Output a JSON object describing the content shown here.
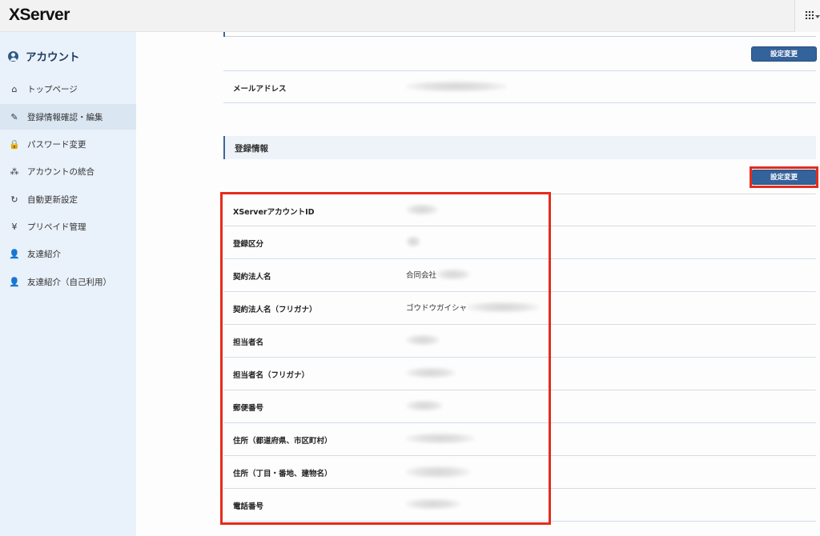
{
  "header": {
    "logo": "XServer",
    "menu_icon": "grid-icon"
  },
  "sidebar": {
    "title": "アカウント",
    "items": [
      {
        "label": "トップページ",
        "icon": "⌂"
      },
      {
        "label": "登録情報確認・編集",
        "icon": "✎",
        "active": true
      },
      {
        "label": "パスワード変更",
        "icon": "🔒"
      },
      {
        "label": "アカウントの統合",
        "icon": "⁂"
      },
      {
        "label": "自動更新設定",
        "icon": "↻"
      },
      {
        "label": "プリペイド管理",
        "icon": "¥"
      },
      {
        "label": "友達紹介",
        "icon": "👤"
      },
      {
        "label": "友達紹介（自己利用）",
        "icon": "👤"
      }
    ]
  },
  "main": {
    "button_label": "設定変更",
    "email_row": {
      "label": "メールアドレス"
    },
    "section_title": "登録情報",
    "rows": [
      {
        "label": "XServerアカウントID",
        "value": ""
      },
      {
        "label": "登録区分",
        "value": ""
      },
      {
        "label": "契約法人名",
        "value": "合同会社"
      },
      {
        "label": "契約法人名（フリガナ）",
        "value": "ゴウドウガイシャ"
      },
      {
        "label": "担当者名",
        "value": ""
      },
      {
        "label": "担当者名（フリガナ）",
        "value": ""
      },
      {
        "label": "郵便番号",
        "value": ""
      },
      {
        "label": "住所（都道府県、市区町村）",
        "value": ""
      },
      {
        "label": "住所（丁目・番地、建物名）",
        "value": ""
      },
      {
        "label": "電話番号",
        "value": ""
      }
    ]
  },
  "colors": {
    "accent": "#34629a",
    "highlight": "#e52b1e",
    "sidebar_bg": "#e9f1fa"
  }
}
